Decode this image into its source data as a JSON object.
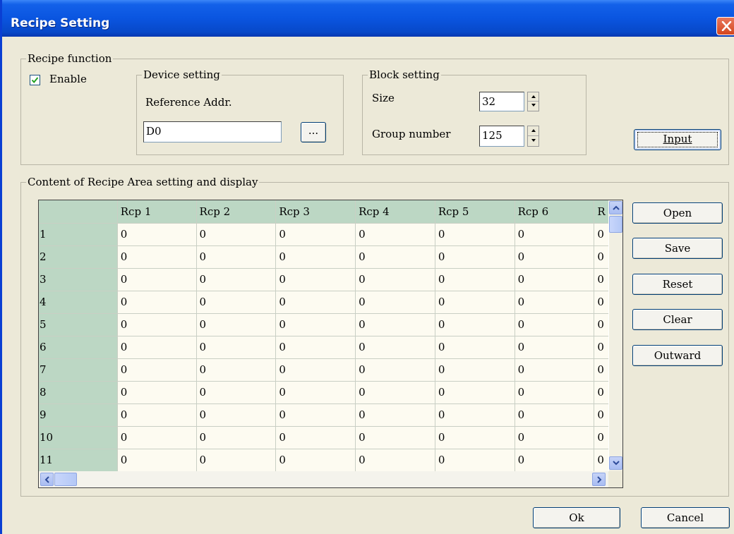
{
  "window": {
    "title": "Recipe Setting"
  },
  "recipe_function": {
    "legend": "Recipe function",
    "enable_label": "Enable",
    "enable_checked": true
  },
  "device_setting": {
    "legend": "Device setting",
    "reference_label": "Reference Addr.",
    "reference_value": "D0",
    "browse_label": "..."
  },
  "block_setting": {
    "legend": "Block setting",
    "size_label": "Size",
    "size_value": "32",
    "group_label": "Group number",
    "group_value": "125"
  },
  "input_button": "Input",
  "content_area": {
    "legend": "Content of Recipe Area setting and display",
    "columns": [
      "Rcp 1",
      "Rcp 2",
      "Rcp 3",
      "Rcp 4",
      "Rcp 5",
      "Rcp 6",
      "R"
    ],
    "rows": [
      {
        "label": "1",
        "values": [
          "0",
          "0",
          "0",
          "0",
          "0",
          "0",
          "0"
        ]
      },
      {
        "label": "2",
        "values": [
          "0",
          "0",
          "0",
          "0",
          "0",
          "0",
          "0"
        ]
      },
      {
        "label": "3",
        "values": [
          "0",
          "0",
          "0",
          "0",
          "0",
          "0",
          "0"
        ]
      },
      {
        "label": "4",
        "values": [
          "0",
          "0",
          "0",
          "0",
          "0",
          "0",
          "0"
        ]
      },
      {
        "label": "5",
        "values": [
          "0",
          "0",
          "0",
          "0",
          "0",
          "0",
          "0"
        ]
      },
      {
        "label": "6",
        "values": [
          "0",
          "0",
          "0",
          "0",
          "0",
          "0",
          "0"
        ]
      },
      {
        "label": "7",
        "values": [
          "0",
          "0",
          "0",
          "0",
          "0",
          "0",
          "0"
        ]
      },
      {
        "label": "8",
        "values": [
          "0",
          "0",
          "0",
          "0",
          "0",
          "0",
          "0"
        ]
      },
      {
        "label": "9",
        "values": [
          "0",
          "0",
          "0",
          "0",
          "0",
          "0",
          "0"
        ]
      },
      {
        "label": "10",
        "values": [
          "0",
          "0",
          "0",
          "0",
          "0",
          "0",
          "0"
        ]
      },
      {
        "label": "11",
        "values": [
          "0",
          "0",
          "0",
          "0",
          "0",
          "0",
          "0"
        ]
      }
    ]
  },
  "side_buttons": {
    "open": "Open",
    "save": "Save",
    "reset": "Reset",
    "clear": "Clear",
    "outward": "Outward"
  },
  "footer": {
    "ok": "Ok",
    "cancel": "Cancel"
  },
  "colors": {
    "title_bar": "#0a55e0",
    "dialog_bg": "#ece9d8",
    "grid_header": "#bcd7c4",
    "grid_cell": "#fdfbf1",
    "close_button": "#d4461e"
  }
}
